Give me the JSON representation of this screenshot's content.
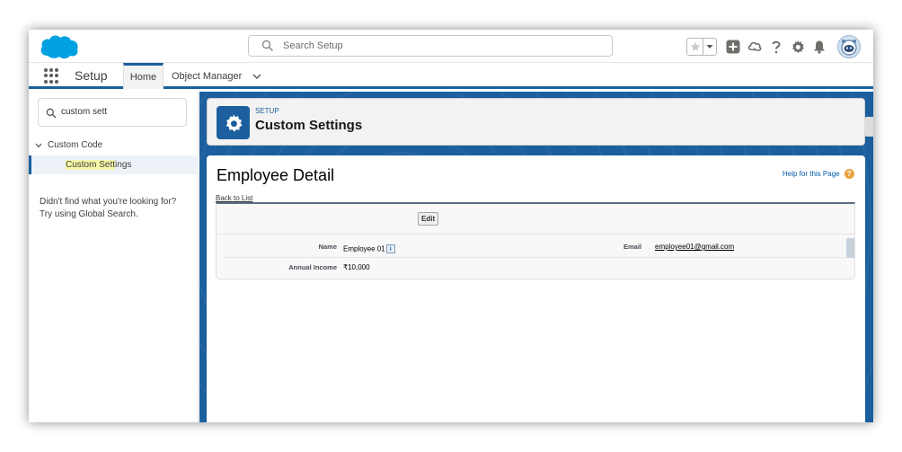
{
  "header": {
    "search_placeholder": "Search Setup"
  },
  "nav": {
    "app_name": "Setup",
    "tabs": [
      {
        "label": "Home"
      },
      {
        "label": "Object Manager"
      }
    ]
  },
  "sidebar": {
    "quickfind_value": "custom sett",
    "group_label": "Custom Code",
    "item_label_pre": "Custom Se",
    "item_label_hl": "tt",
    "item_label_post": "ings",
    "no_find_line1": "Didn't find what you're looking for?",
    "no_find_line2": "Try using Global Search."
  },
  "page_header": {
    "subtitle": "SETUP",
    "title": "Custom Settings"
  },
  "detail": {
    "title": "Employee Detail",
    "help_label": "Help for this Page",
    "help_icon_glyph": "?",
    "info_icon_glyph": "i",
    "back_label": "Back to List",
    "edit_label": "Edit",
    "fields": {
      "name_label": "Name",
      "name_value": "Employee 01",
      "email_label": "Email",
      "email_value": "employee01@gmail.com",
      "income_label": "Annual Income",
      "income_value": "₹10,000"
    }
  },
  "colors": {
    "brand_blue": "#1b5f9e",
    "cloud_blue": "#00a1e0",
    "link_blue": "#015ba7",
    "help_orange": "#e8a33d",
    "highlight_yellow": "#f6f6a8"
  }
}
